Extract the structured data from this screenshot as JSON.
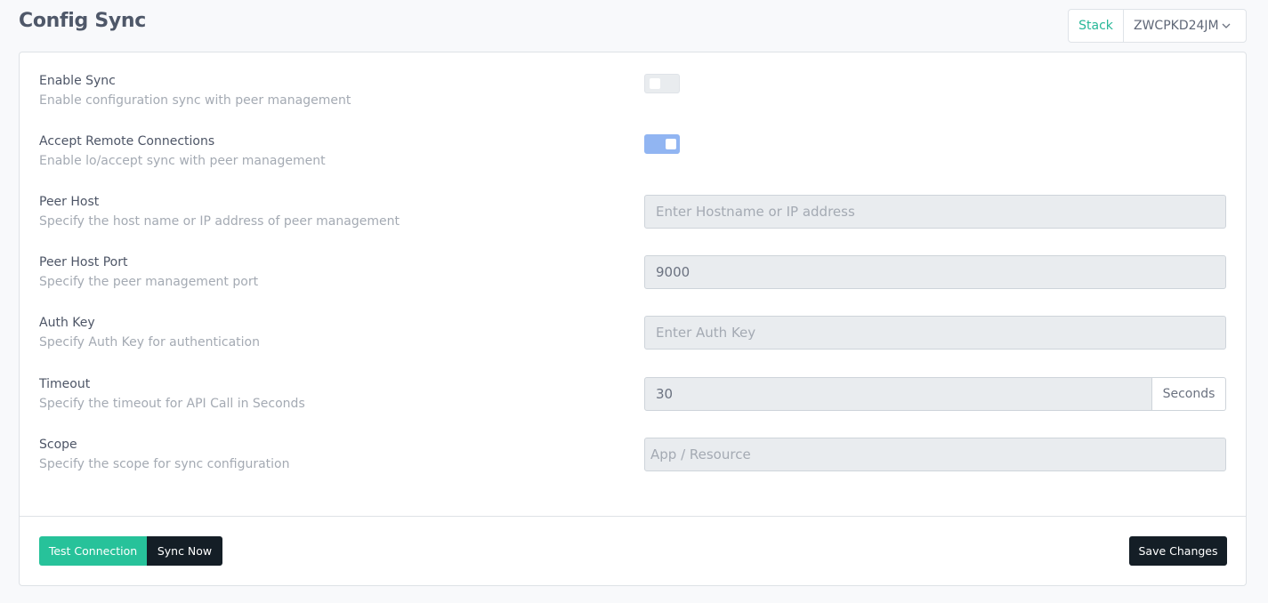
{
  "page": {
    "title": "Config Sync"
  },
  "stack": {
    "label": "Stack",
    "value": "ZWCPKD24JM"
  },
  "settings": [
    {
      "label": "Enable Sync",
      "description": "Enable configuration sync with peer management",
      "control": "toggle",
      "checked": false
    },
    {
      "label": "Accept Remote Connections",
      "description": "Enable lo/accept sync with peer management",
      "control": "toggle",
      "checked": true
    },
    {
      "label": "Peer Host",
      "description": "Specify the host name or IP address of peer management",
      "control": "input",
      "value": "",
      "placeholder": "Enter Hostname or IP address"
    },
    {
      "label": "Peer Host Port",
      "description": "Specify the peer management port",
      "control": "input",
      "value": "9000",
      "placeholder": ""
    },
    {
      "label": "Auth Key",
      "description": "Specify Auth Key for authentication",
      "control": "input",
      "value": "",
      "placeholder": "Enter Auth Key"
    },
    {
      "label": "Timeout",
      "description": "Specify the timeout for API Call in Seconds",
      "control": "input-addon",
      "value": "30",
      "addon": "Seconds"
    },
    {
      "label": "Scope",
      "description": "Specify the scope for sync configuration",
      "control": "input",
      "value": "",
      "placeholder": "App / Resource"
    }
  ],
  "footer": {
    "test_label": "Test Connection",
    "sync_label": "Sync Now",
    "save_label": "Save Changes"
  },
  "colors": {
    "accent": "#27c29a",
    "dark": "#141e26",
    "toggle_on": "#91b5f2"
  }
}
